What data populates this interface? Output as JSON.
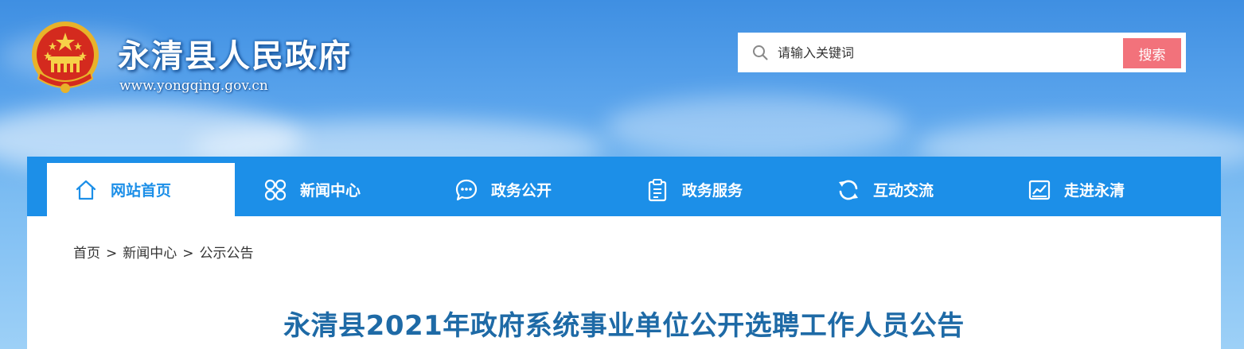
{
  "header": {
    "site_title": "永清县人民政府",
    "site_url": "www.yongqing.gov.cn"
  },
  "search": {
    "placeholder": "请输入关键词",
    "button_label": "搜索",
    "button_color": "#f2727b"
  },
  "nav": {
    "accent_color": "#1c8fe8",
    "items": [
      {
        "label": "网站首页",
        "icon": "home-icon",
        "active": true
      },
      {
        "label": "新闻中心",
        "icon": "grid-icon",
        "active": false
      },
      {
        "label": "政务公开",
        "icon": "chat-icon",
        "active": false
      },
      {
        "label": "政务服务",
        "icon": "clipboard-icon",
        "active": false
      },
      {
        "label": "互动交流",
        "icon": "refresh-icon",
        "active": false
      },
      {
        "label": "走进永清",
        "icon": "chart-icon",
        "active": false
      }
    ]
  },
  "breadcrumb": {
    "items": [
      "首页",
      "新闻中心",
      "公示公告"
    ],
    "separator": ">"
  },
  "article": {
    "title": "永清县2021年政府系统事业单位公开选聘工作人员公告",
    "title_color": "#1e6aa6"
  }
}
